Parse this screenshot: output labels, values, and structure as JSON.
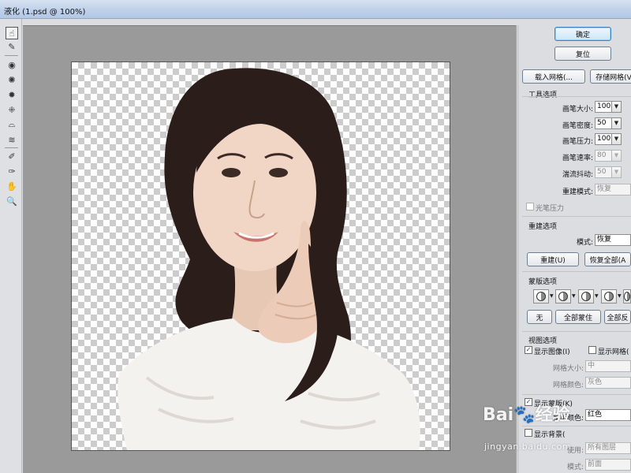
{
  "window": {
    "title": "液化 (1.psd @ 100%)"
  },
  "toolbar": {
    "tools": [
      {
        "name": "forward-warp-tool",
        "glyph": "☝"
      },
      {
        "name": "reconstruct-tool",
        "glyph": "✎"
      },
      {
        "name": "twirl-clockwise-tool",
        "glyph": "◉"
      },
      {
        "name": "pucker-tool",
        "glyph": "✺"
      },
      {
        "name": "bloat-tool",
        "glyph": "✹"
      },
      {
        "name": "push-left-tool",
        "glyph": "⁜"
      },
      {
        "name": "mirror-tool",
        "glyph": "⌓"
      },
      {
        "name": "turbulence-tool",
        "glyph": "≋"
      },
      {
        "name": "freeze-mask-tool",
        "glyph": "✐"
      },
      {
        "name": "thaw-mask-tool",
        "glyph": "✑"
      },
      {
        "name": "hand-tool",
        "glyph": "✋"
      },
      {
        "name": "zoom-tool",
        "glyph": "🔍"
      }
    ]
  },
  "buttons": {
    "ok": "确定",
    "reset": "复位",
    "load_mesh": "载入网格(...",
    "save_mesh": "存储网格(V"
  },
  "tool_options": {
    "heading": "工具选项",
    "brush_size_label": "画笔大小:",
    "brush_size": "100",
    "brush_density_label": "画笔密度:",
    "brush_density": "50",
    "brush_pressure_label": "画笔压力:",
    "brush_pressure": "100",
    "brush_rate_label": "画笔速率:",
    "brush_rate": "80",
    "turbulent_jitter_label": "湍流抖动:",
    "turbulent_jitter": "50",
    "reconstruct_mode_label": "重建模式:",
    "reconstruct_mode": "恢复",
    "stylus_pressure_label": "光笔压力"
  },
  "reconstruct_options": {
    "heading": "重建选项",
    "mode_label": "模式:",
    "mode": "恢复",
    "reconstruct_button": "重建(U)",
    "restore_all_button": "恢复全部(A"
  },
  "mask_options": {
    "heading": "蒙版选项",
    "none_button": "无",
    "mask_all_button": "全部蒙住",
    "invert_all_button": "全部反"
  },
  "view_options": {
    "heading": "视图选项",
    "show_image_label": "显示图像(I)",
    "show_image_checked": true,
    "show_mesh_label": "显示网格(",
    "show_mesh_checked": false,
    "mesh_size_label": "网格大小:",
    "mesh_size": "中",
    "mesh_color_label": "网格颜色:",
    "mesh_color": "灰色",
    "show_mask_label": "显示蒙版(K)",
    "show_mask_checked": true,
    "mask_color_label": "蒙版颜色:",
    "mask_color": "红色",
    "show_backdrop_label": "显示背景(",
    "use_label": "使用:",
    "use_value": "所有图层",
    "mode_label": "模式:",
    "mode_value": "前面"
  },
  "watermark": {
    "logo": "Bai🐾经验",
    "url": "jingyan.baidu.com"
  },
  "colors": {
    "canvas_bg": "#9a9a9a",
    "panel_bg": "#dcdde1",
    "titlebar": "#bfd1ea",
    "primary_button_border": "#3b82c4"
  }
}
